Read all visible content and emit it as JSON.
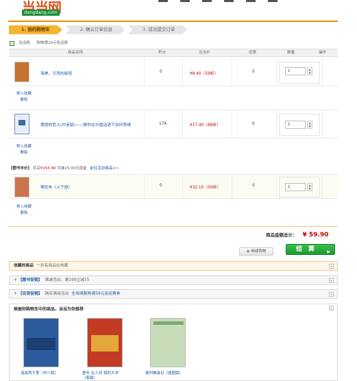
{
  "header": {
    "logo_cn": "当当网",
    "logo_en": "dangdang.com"
  },
  "steps": [
    {
      "label": "1. 我的购物车",
      "active": true
    },
    {
      "label": "2. 确认订单信息",
      "active": false
    },
    {
      "label": "3. 成功提交订单",
      "active": false
    }
  ],
  "select_row": {
    "label": "当当网",
    "note": "购物满29元免运费"
  },
  "table": {
    "headers": [
      "商品名称",
      "积分",
      "当当价",
      "优惠",
      "数量",
      "操作"
    ],
    "rows": [
      {
        "name": "海棠、贝壳的秘密",
        "points": "0",
        "price": "¥8.40（59折）",
        "discount": "0",
        "qty": "1",
        "actions": [
          "移入收藏",
          "删除"
        ],
        "cover_color": "#c8722e"
      },
      {
        "name": "摆渡的哲人(中英版)——教你在中国话语下如何思维",
        "points": "174",
        "price": "¥17.40（68折）",
        "discount": "0",
        "qty": "1",
        "actions": [
          "移入收藏",
          "删除"
        ],
        "cover_color": "#3d6aa8"
      },
      {
        "name": "哥伦布（上下册）",
        "points": "0",
        "price": "¥32.10（50折）",
        "discount": "0",
        "qty": "1",
        "actions": [
          "移入收藏",
          "删除"
        ],
        "cover_color": "#c9744a"
      }
    ]
  },
  "promo": {
    "tag": "【图书半价】",
    "text": "共买",
    "amount": "¥155.90",
    "text2": "可减15.00元现金",
    "link": "前往活动商品>>"
  },
  "total": {
    "label": "商品金额总计：",
    "amount": "¥ 59.90"
  },
  "buttons": {
    "keep": "继续购物",
    "checkout": "结　算"
  },
  "sections": [
    {
      "title": "收藏的商品",
      "note": "一共有商品在收藏",
      "extra": ""
    },
    {
      "title": "【图书促销】",
      "note": "满减活动，满199立减15",
      "extra": ""
    },
    {
      "title": "【百货促销】",
      "note": "跨店满减活动",
      "extra": "全场满额购满59元送运费券"
    }
  ],
  "recommend": {
    "title": "根据你购物车中的商品，当当为你推荐",
    "books": [
      {
        "caption": "海底两万里（中少版）",
        "cover_color": "#2d5c9e"
      },
      {
        "caption": "童年 在人间 我的大学（套装）",
        "cover_color": "#c23a24"
      },
      {
        "caption": "格列佛游记（插图版）",
        "cover_color": "#7ea870"
      }
    ]
  },
  "colors": {
    "brand_orange": "#f08a00",
    "price_red": "#c40000",
    "pay_green": "#1fa534",
    "link_blue": "#1e5aa8"
  }
}
